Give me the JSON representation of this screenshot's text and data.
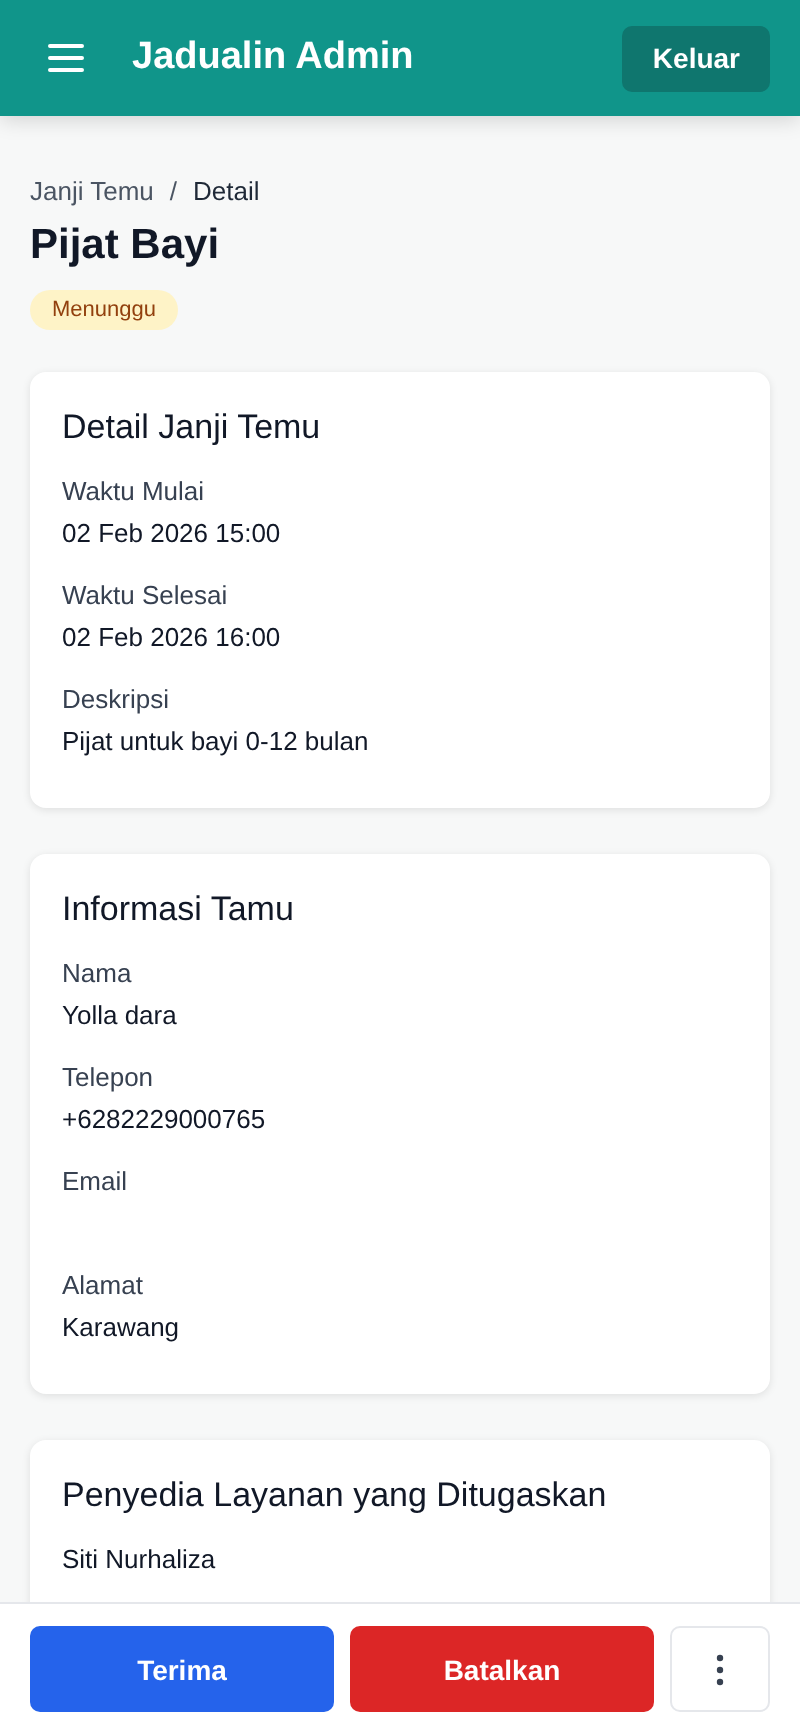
{
  "header": {
    "title": "Jadualin Admin",
    "logout": "Keluar"
  },
  "breadcrumb": [
    "Janji Temu",
    "Detail"
  ],
  "breadcrumb_separator": "/",
  "page_title": "Pijat Bayi",
  "status": {
    "label": "Menunggu",
    "kind": "pending"
  },
  "cards": [
    {
      "title": "Detail Janji Temu",
      "fields": [
        {
          "label": "Waktu Mulai",
          "value": "02 Feb 2026 15:00"
        },
        {
          "label": "Waktu Selesai",
          "value": "02 Feb 2026 16:00"
        },
        {
          "label": "Deskripsi",
          "value": "Pijat untuk bayi 0-12 bulan"
        }
      ]
    },
    {
      "title": "Informasi Tamu",
      "fields": [
        {
          "label": "Nama",
          "value": "Yolla dara"
        },
        {
          "label": "Telepon",
          "value": "+6282229000765"
        },
        {
          "label": "Email"
        },
        {
          "label": "Alamat",
          "value": "Karawang"
        }
      ]
    },
    {
      "title": "Penyedia Layanan yang Ditugaskan",
      "fields": [
        {
          "value": "Siti Nurhaliza"
        }
      ]
    }
  ],
  "actions": {
    "accept": "Terima",
    "cancel": "Batalkan"
  }
}
